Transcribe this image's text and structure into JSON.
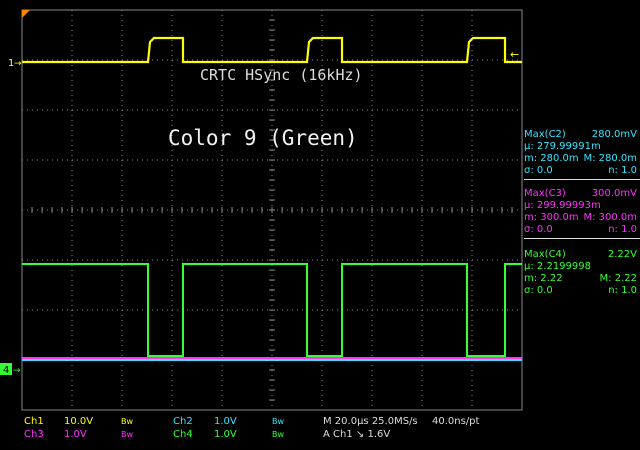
{
  "trace_label": "CRTC HSync (16kHz)",
  "main_label": "Color 9 (Green)",
  "colors": {
    "ch1": "#ffff00",
    "ch2": "#33e6ff",
    "ch3": "#ff33ff",
    "ch4": "#33ff33",
    "grid": "#888888",
    "trigger": "#ff8800"
  },
  "markers": {
    "ch1": "1",
    "ch4": "4"
  },
  "measurements": [
    {
      "title": "Max(C2)",
      "value": "280.0mV",
      "mu": "μ: 279.99991m",
      "m": "m: 280.0m",
      "M": "M: 280.0m",
      "sigma": "σ: 0.0",
      "n": "n: 1.0"
    },
    {
      "title": "Max(C3)",
      "value": "300.0mV",
      "mu": "μ: 299.99993m",
      "m": "m: 300.0m",
      "M": "M: 300.0m",
      "sigma": "σ: 0.0",
      "n": "n: 1.0"
    },
    {
      "title": "Max(C4)",
      "value": "2.22V",
      "mu": "μ: 2.2199998",
      "m": "m: 2.22",
      "M": "M: 2.22",
      "sigma": "σ: 0.0",
      "n": "n: 1.0"
    }
  ],
  "status": {
    "ch1": "Ch1",
    "ch1_scale": "10.0V",
    "ch3": "Ch3",
    "ch3_scale": "1.0V",
    "ch2": "Ch2",
    "ch2_scale": "1.0V",
    "ch4": "Ch4",
    "ch4_scale": "1.0V",
    "bw": "Bw",
    "timebase": "M 20.0μs 25.0MS/s",
    "sample_interval": "40.0ns/pt",
    "trigger": "A Ch1 ↘ 1.6V"
  },
  "waveforms": {
    "ch1_edges": [
      [
        22,
        148,
        183
      ],
      [
        148,
        183,
        307
      ],
      [
        183,
        307,
        342
      ],
      [
        307,
        342,
        467
      ],
      [
        342,
        467,
        505
      ],
      [
        467,
        505,
        522
      ]
    ],
    "ch4_low_intervals": [
      [
        148,
        183
      ],
      [
        307,
        342
      ],
      [
        467,
        505
      ]
    ]
  }
}
